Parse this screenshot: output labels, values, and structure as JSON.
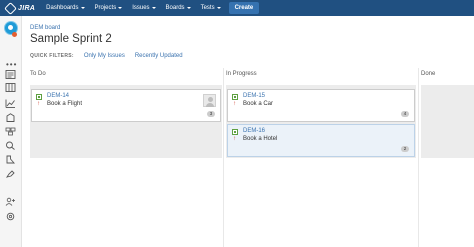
{
  "topbar": {
    "logo_text": "JIRA",
    "nav": [
      {
        "label": "Dashboards"
      },
      {
        "label": "Projects"
      },
      {
        "label": "Issues"
      },
      {
        "label": "Boards"
      },
      {
        "label": "Tests"
      }
    ],
    "create_label": "Create",
    "bar_color": "#205081"
  },
  "sidebar": {
    "more_label": "•••",
    "icons": [
      "backlog-icon",
      "board-icon",
      "reports-icon",
      "releases-icon",
      "components-icon",
      "issues-icon",
      "tests-icon",
      "add-item-icon",
      "add-person-icon",
      "settings-icon"
    ]
  },
  "board": {
    "breadcrumb": "DEM board",
    "title": "Sample Sprint 2",
    "quick_filters_label": "QUICK FILTERS:",
    "quick_filters": [
      "Only My Issues",
      "Recently Updated"
    ],
    "columns": [
      {
        "name": "To Do"
      },
      {
        "name": "In Progress"
      },
      {
        "name": "Done"
      }
    ],
    "cards": [
      {
        "key": "DEM-14",
        "summary": "Book a Flight",
        "estimate": "3",
        "priority": "↑"
      },
      {
        "key": "DEM-15",
        "summary": "Book a Car",
        "estimate": "4",
        "priority": "↑"
      },
      {
        "key": "DEM-16",
        "summary": "Book a Hotel",
        "estimate": "2",
        "priority": "↑"
      }
    ]
  }
}
